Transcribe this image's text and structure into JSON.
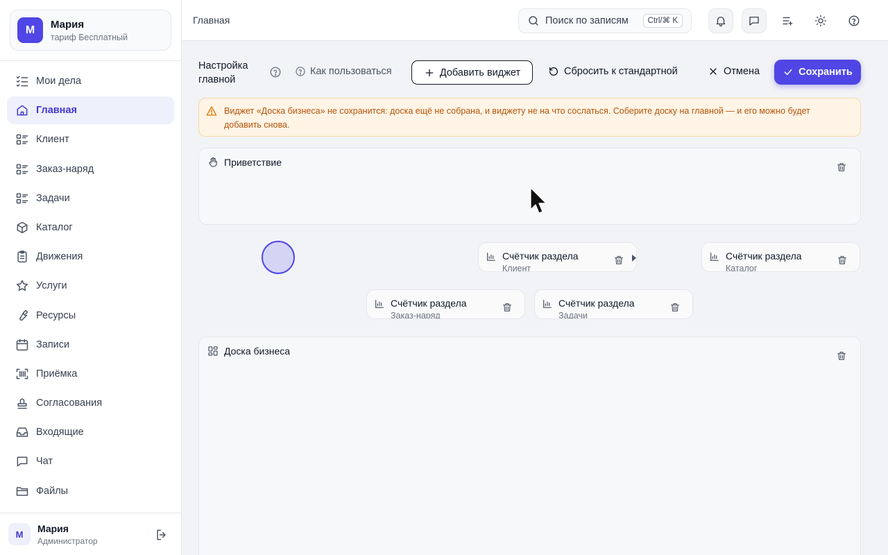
{
  "account": {
    "initial": "М",
    "name": "Мария",
    "plan": "тариф Бесплатный"
  },
  "nav": [
    {
      "label": "Мои дела",
      "icon": "list-check-icon"
    },
    {
      "label": "Главная",
      "icon": "home-icon",
      "active": true
    },
    {
      "label": "Клиент",
      "icon": "list-icon"
    },
    {
      "label": "Заказ-наряд",
      "icon": "list-icon"
    },
    {
      "label": "Задачи",
      "icon": "list-icon"
    },
    {
      "label": "Каталог",
      "icon": "box-icon"
    },
    {
      "label": "Движения",
      "icon": "clipboard-icon"
    },
    {
      "label": "Услуги",
      "icon": "star-icon"
    },
    {
      "label": "Ресурсы",
      "icon": "wrench-icon"
    },
    {
      "label": "Записи",
      "icon": "calendar-icon"
    },
    {
      "label": "Приёмка",
      "icon": "barcode-scan-icon"
    },
    {
      "label": "Согласования",
      "icon": "stamp-icon"
    },
    {
      "label": "Входящие",
      "icon": "inbox-icon"
    },
    {
      "label": "Чат",
      "icon": "chat-icon"
    },
    {
      "label": "Файлы",
      "icon": "folder-icon"
    }
  ],
  "footer": {
    "initial": "М",
    "name": "Мария",
    "role": "Администратор"
  },
  "topbar": {
    "breadcrumb": "Главная",
    "search_placeholder": "Поиск по записям",
    "search_shortcut": "Ctrl/⌘ K"
  },
  "toolbar": {
    "title": "Настройка главной",
    "howto": "Как пользоваться",
    "add_widget": "Добавить виджет",
    "reset": "Сбросить к стандартной",
    "cancel": "Отмена",
    "save": "Сохранить"
  },
  "warning": "Виджет «Доска бизнеса» не сохранится: доска ещё не собрана, и виджету не на что сослаться. Соберите доску на главной — и его можно будет добавить снова.",
  "widgets": {
    "greeting": "Приветствие",
    "board": "Доска бизнеса",
    "counters": [
      {
        "title": "Счётчик раздела",
        "section": "Клиент"
      },
      {
        "title": "Счётчик раздела",
        "section": "Каталог"
      },
      {
        "title": "Счётчик раздела",
        "section": "Заказ-наряд"
      },
      {
        "title": "Счётчик раздела",
        "section": "Задачи"
      }
    ]
  },
  "colors": {
    "accent": "#4f46e5",
    "warning_bg": "#fff4e5",
    "warning_text": "#b45309"
  }
}
